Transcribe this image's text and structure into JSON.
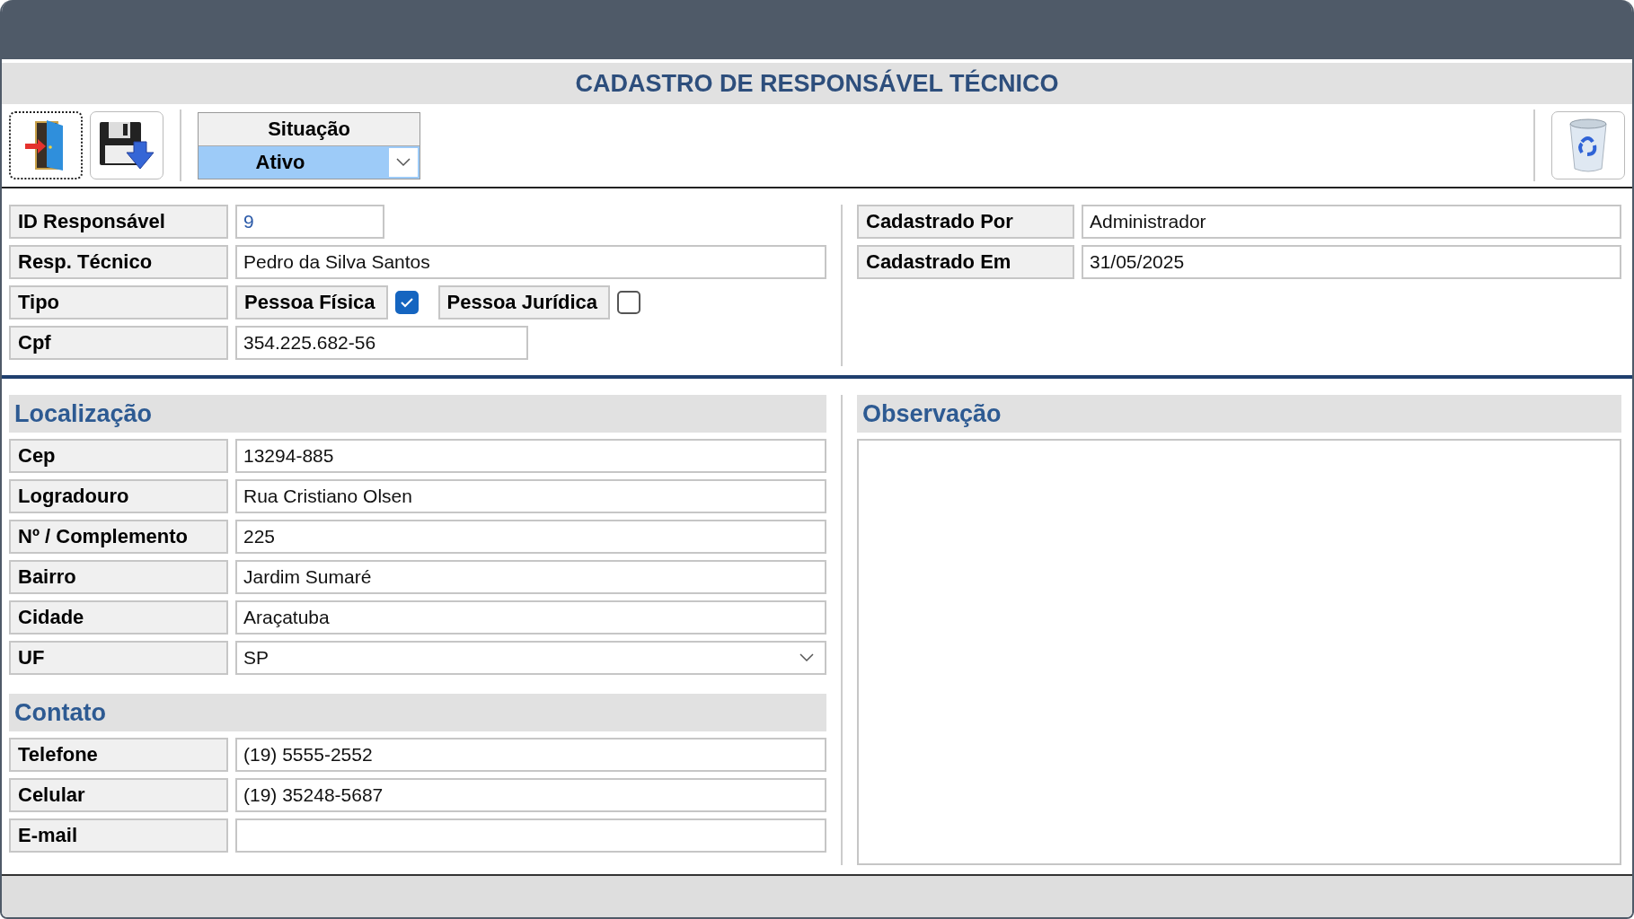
{
  "title": "CADASTRO DE RESPONSÁVEL TÉCNICO",
  "toolbar": {
    "situacao": {
      "label": "Situação",
      "value": "Ativo"
    }
  },
  "identificacao": [
    {
      "kind": "id",
      "label": "ID Responsável",
      "value": "9"
    },
    {
      "kind": "text",
      "label": "Resp. Técnico",
      "value": "Pedro da Silva Santos"
    },
    {
      "kind": "options",
      "label": "Tipo",
      "options": [
        {
          "label": "Pessoa Física",
          "checked": true
        },
        {
          "label": "Pessoa Jurídica",
          "checked": false
        }
      ]
    },
    {
      "kind": "document",
      "label": "Cpf",
      "value": "354.225.682-56"
    }
  ],
  "registro": [
    {
      "label": "Cadastrado Por",
      "value": "Administrador"
    },
    {
      "label": "Cadastrado Em",
      "value": "31/05/2025"
    }
  ],
  "localizacao": {
    "title": "Localização",
    "fields": [
      {
        "kind": "text",
        "label": "Cep",
        "value": "13294-885"
      },
      {
        "kind": "text",
        "label": "Logradouro",
        "value": "Rua Cristiano Olsen"
      },
      {
        "kind": "text",
        "label": "Nº / Complemento",
        "value": "225"
      },
      {
        "kind": "text",
        "label": "Bairro",
        "value": "Jardim Sumaré"
      },
      {
        "kind": "text",
        "label": "Cidade",
        "value": "Araçatuba"
      },
      {
        "kind": "select",
        "label": "UF",
        "value": "SP"
      }
    ]
  },
  "contato": {
    "title": "Contato",
    "fields": [
      {
        "kind": "text",
        "label": "Telefone",
        "value": "(19) 5555-2552"
      },
      {
        "kind": "text",
        "label": "Celular",
        "value": "(19) 35248-5687"
      },
      {
        "kind": "text",
        "label": "E-mail"
      }
    ]
  },
  "observacao": {
    "title": "Observação"
  }
}
